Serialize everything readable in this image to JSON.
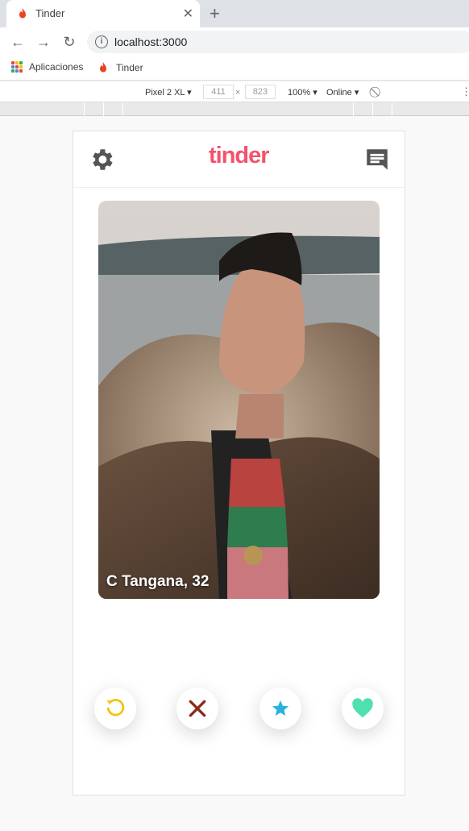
{
  "browser": {
    "tab_title": "Tinder",
    "url": "localhost:3000",
    "bookmarks": [
      "Aplicaciones",
      "Tinder"
    ]
  },
  "devtools": {
    "device": "Pixel 2 XL",
    "width": "411",
    "height": "823",
    "zoom": "100%",
    "network": "Online"
  },
  "app": {
    "logo": "tinder",
    "colors": {
      "brand": "#f3536d",
      "redo": "#f6c30e",
      "nope": "#8a2a15",
      "star": "#2ab2dc",
      "like": "#4ee0b0"
    },
    "card": {
      "name": "C Tangana, 32"
    },
    "actions": [
      "redo-icon",
      "close-icon",
      "star-icon",
      "heart-icon"
    ]
  }
}
